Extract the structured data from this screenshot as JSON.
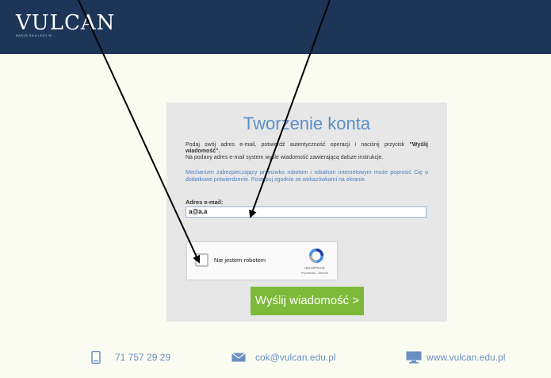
{
  "header": {
    "brand": "VULCAN",
    "tagline": "NASZA SIŁA LEŻY W ...."
  },
  "form": {
    "title": "Tworzenie konta",
    "intro_line1_pre": "Podaj swój adres e-mail, potwierdź autentyczność operacji i naciśnij przycisk",
    "intro_bold": "\"Wyślij wiadomość\".",
    "intro_line2": "Na podany adres e-mail system wyśle wiadomość zawierającą dalsze instrukcje.",
    "note": "Mechanizm zabezpieczający przeciwko robotom i robakom internetowym może poprosić Cię o dodatkowe potwierdzenie. Postępuj zgodnie ze wskazówkami na ekranie.",
    "email_label": "Adres e-mail:",
    "email_value": "a@a.a",
    "captcha_label": "Nie jestem robotem",
    "captcha_brand": "reCAPTCHA",
    "captcha_links": "Prywatność - Warunki",
    "submit_label": "Wyślij wiadomość >"
  },
  "footer": {
    "phone": "71 757 29 29",
    "email": "cok@vulcan.edu.pl",
    "website": "www.vulcan.edu.pl"
  },
  "colors": {
    "header_bg": "#1d3557",
    "accent_blue": "#5a8fc8",
    "button_green": "#7dba3a",
    "page_bg": "#fbfcf1"
  }
}
